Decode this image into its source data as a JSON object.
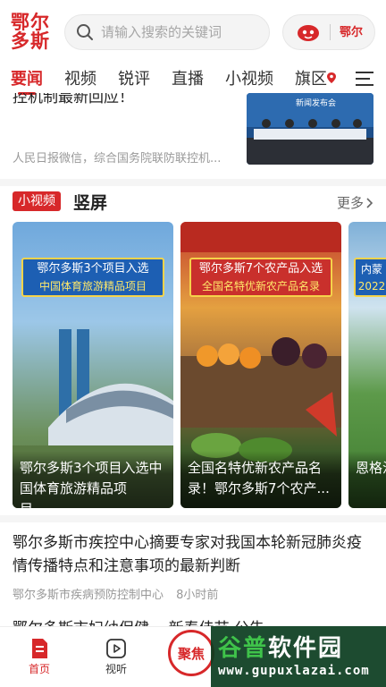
{
  "header": {
    "logo_line1": "鄂尔",
    "logo_line2": "多斯",
    "search_placeholder": "请输入搜索的关键词",
    "profile_seal": "鄂尔"
  },
  "tabs": [
    {
      "label": "要闻",
      "active": true
    },
    {
      "label": "视频",
      "active": false
    },
    {
      "label": "锐评",
      "active": false
    },
    {
      "label": "直播",
      "active": false
    },
    {
      "label": "小视频",
      "active": false
    },
    {
      "label": "旗区",
      "active": false
    }
  ],
  "top_news": {
    "title": "控机制最新回应！",
    "source": "人民日报微信，综合国务院联防联控机...",
    "thumb_label": "新闻发布会"
  },
  "video_section": {
    "badge": "小视频",
    "title": "竖屏",
    "more": "更多",
    "cards": [
      {
        "banner": "鄂尔多斯3个项目入选",
        "banner_sub": "中国体育旅游精品项目",
        "caption": "鄂尔多斯3个项目入选中国体育旅游精品项目，..."
      },
      {
        "banner": "鄂尔多斯7个农产品入选",
        "banner_sub": "全国名特优新农产品名录",
        "caption": "全国名特优新农产品名录！鄂尔多斯7个农产..."
      },
      {
        "banner": "内蒙",
        "banner_sub": "2022",
        "caption": "恩格治理"
      }
    ]
  },
  "article": {
    "title": "鄂尔多斯市疾控中心摘要专家对我国本轮新冠肺炎疫情传播特点和注意事项的最新判断",
    "source": "鄂尔多斯市疾病预防控制中心",
    "time": "8小时前"
  },
  "article2": {
    "title": "鄂尔多斯市妇幼保健... 新春佳节 公告"
  },
  "bottom_nav": {
    "home": "首页",
    "video": "视听",
    "focus": "聚焦"
  },
  "watermark": {
    "main_g": "谷普",
    "main_rest": "软件园",
    "url": "www.gupuxlazai.com"
  },
  "colors": {
    "brand_red": "#d7282a"
  }
}
